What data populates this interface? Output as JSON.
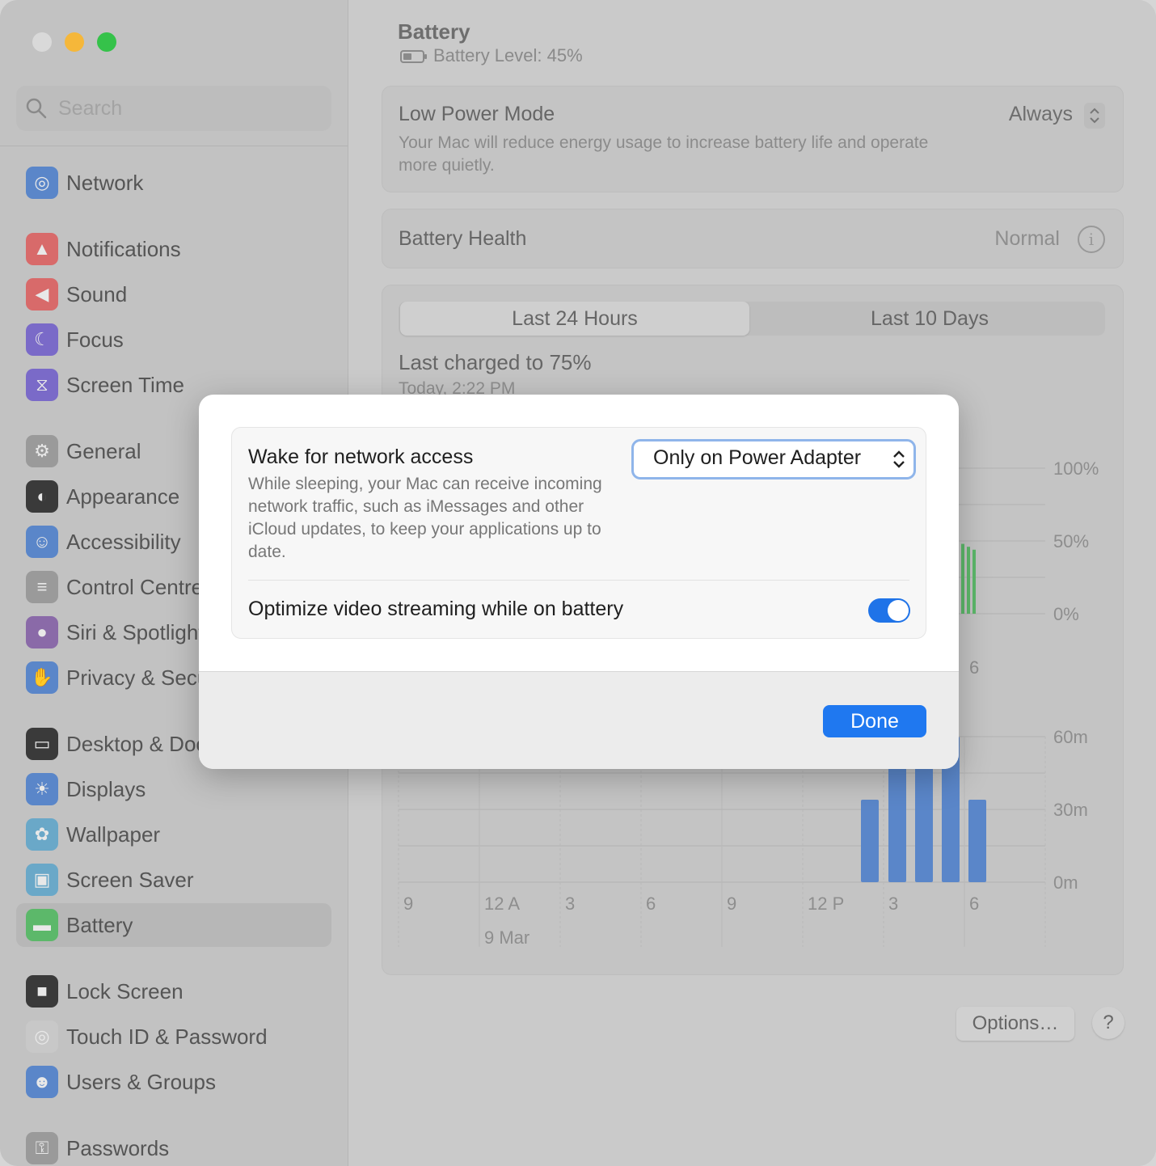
{
  "window": {
    "sidebar": {
      "search_placeholder": "Search",
      "items": [
        {
          "label": "Network",
          "icon": "globe-icon",
          "color": "#5a86c9",
          "glyph": "◎"
        },
        {
          "label": "Notifications",
          "icon": "bell-icon",
          "color": "#d86a6a",
          "glyph": "▲"
        },
        {
          "label": "Sound",
          "icon": "speaker-icon",
          "color": "#d86a6a",
          "glyph": "◀"
        },
        {
          "label": "Focus",
          "icon": "moon-icon",
          "color": "#7a6ac8",
          "glyph": "☾"
        },
        {
          "label": "Screen Time",
          "icon": "hourglass-icon",
          "color": "#7a6ac8",
          "glyph": "⧖"
        },
        {
          "label": "General",
          "icon": "gear-icon",
          "color": "#9a9a9a",
          "glyph": "⚙"
        },
        {
          "label": "Appearance",
          "icon": "appearance-icon",
          "color": "#3a3a3a",
          "glyph": "◐"
        },
        {
          "label": "Accessibility",
          "icon": "accessibility-icon",
          "color": "#5a86c9",
          "glyph": "☺"
        },
        {
          "label": "Control Centre",
          "icon": "toggles-icon",
          "color": "#9a9a9a",
          "glyph": "≡"
        },
        {
          "label": "Siri & Spotlight",
          "icon": "siri-icon",
          "color": "#8a6aa8",
          "glyph": "●"
        },
        {
          "label": "Privacy & Security",
          "icon": "hand-icon",
          "color": "#5a86c9",
          "glyph": "✋"
        },
        {
          "label": "Desktop & Dock",
          "icon": "dock-icon",
          "color": "#3a3a3a",
          "glyph": "▭"
        },
        {
          "label": "Displays",
          "icon": "sun-icon",
          "color": "#5a86c9",
          "glyph": "☀"
        },
        {
          "label": "Wallpaper",
          "icon": "flower-icon",
          "color": "#6aa8c8",
          "glyph": "✿"
        },
        {
          "label": "Screen Saver",
          "icon": "screensaver-icon",
          "color": "#6aa8c8",
          "glyph": "▣"
        },
        {
          "label": "Battery",
          "icon": "battery-icon",
          "color": "#5cb86a",
          "glyph": "▬"
        },
        {
          "label": "Lock Screen",
          "icon": "lock-icon",
          "color": "#3a3a3a",
          "glyph": "■"
        },
        {
          "label": "Touch ID & Password",
          "icon": "fingerprint-icon",
          "color": "#c8c8c8",
          "glyph": "◎"
        },
        {
          "label": "Users & Groups",
          "icon": "users-icon",
          "color": "#5a86c9",
          "glyph": "☻"
        },
        {
          "label": "Passwords",
          "icon": "key-icon",
          "color": "#9a9a9a",
          "glyph": "⚿"
        }
      ]
    },
    "main": {
      "title": "Battery",
      "battery_level": "Battery Level: 45%",
      "low_power_mode": {
        "title": "Low Power Mode",
        "description": "Your Mac will reduce energy usage to increase battery life and operate more quietly.",
        "value": "Always"
      },
      "battery_health": {
        "title": "Battery Health",
        "value": "Normal"
      },
      "tabs": {
        "active": "Last 24 Hours",
        "inactive": "Last 10 Days"
      },
      "last_charged": "Last charged to 75%",
      "last_charged_time": "Today, 2:22 PM",
      "options_button": "Options…",
      "help_button": "?"
    },
    "modal": {
      "wake_title": "Wake for network access",
      "wake_description": "While sleeping, your Mac can receive incoming network traffic, such as iMessages and other iCloud updates, to keep your applications up to date.",
      "wake_value": "Only on Power Adapter",
      "optimize_title": "Optimize video streaming while on battery",
      "optimize_on": true,
      "done_label": "Done"
    }
  },
  "chart_data": [
    {
      "type": "bar",
      "description_axis_right": [
        "100%",
        "50%",
        "0%"
      ],
      "ylim": [
        0,
        100
      ],
      "x_tick_visible": [
        "6"
      ],
      "series": [
        {
          "values": [
            48,
            46,
            44
          ]
        }
      ],
      "color": "#5cb86a"
    },
    {
      "type": "bar",
      "y_ticks": [
        "60m",
        "30m",
        "0m"
      ],
      "ylim": [
        0,
        60
      ],
      "x_ticks": [
        "9",
        "12 A",
        "3",
        "6",
        "9",
        "12 P",
        "3",
        "6"
      ],
      "x_sublabel": "9 Mar",
      "bar_values_minutes": [
        34,
        60,
        60,
        60,
        34
      ],
      "color": "#5a86c9"
    }
  ],
  "colors": {
    "accent": "#1f78f0",
    "toggle_on": "#1f73e8",
    "popup_focus": "#8fb5ea"
  }
}
